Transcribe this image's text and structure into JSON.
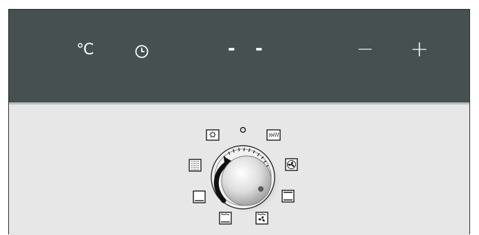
{
  "display": {
    "temperature_label": "°C",
    "time_icon": "clock-icon",
    "value_readout": "- -",
    "minus_label": "−",
    "plus_label": "+"
  },
  "knob": {
    "off_marker": "off-position",
    "modes": [
      "oven-light",
      "grill-large",
      "bottom-heat",
      "bottom-heat-with-pizza",
      "fan-grill",
      "top-bottom-heat",
      "fan-heat",
      "rapid-heat"
    ]
  },
  "colors": {
    "display_bg": "#465050",
    "panel_bg": "#e6e7e6",
    "text": "#ffffff"
  }
}
